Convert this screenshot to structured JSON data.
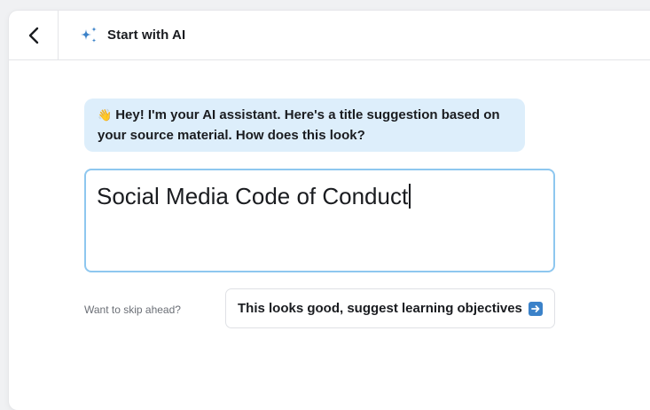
{
  "header": {
    "title": "Start with AI",
    "back_icon": "chevron-left-icon",
    "title_icon": "sparkle-icon",
    "accent_color": "#3b82c9"
  },
  "assistant": {
    "emoji": "👋",
    "message": "Hey! I'm your AI assistant. Here's a title suggestion based on your source material. How does this look?",
    "bubble_color": "#ddeefb"
  },
  "title_input": {
    "value": "Social Media Code of Conduct"
  },
  "footer": {
    "skip_label": "Want to skip ahead?",
    "suggest_button_label": "This looks good, suggest learning objectives",
    "suggest_button_icon": "arrow-right-icon"
  }
}
